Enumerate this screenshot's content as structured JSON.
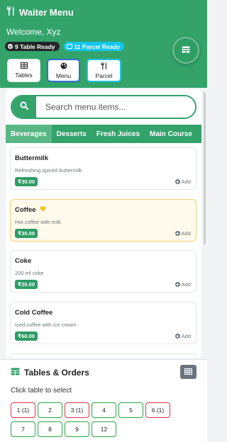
{
  "header": {
    "title": "Waiter Menu",
    "welcome": "Welcome, Xyz",
    "badges": {
      "tables_ready": "9 Table Ready",
      "parcel_ready": "11 Parcel Ready"
    },
    "nav": {
      "tables": "Tables",
      "menu": "Menu",
      "parcel": "Parcel"
    },
    "active_nav": "Menu"
  },
  "search": {
    "placeholder": "Search menu items..."
  },
  "tabs": [
    "Beverages",
    "Desserts",
    "Fresh Juices",
    "Main Course"
  ],
  "active_tab": "Beverages",
  "items": [
    {
      "name": "Buttermilk",
      "desc": "Refreshing spiced buttermilk",
      "price": "₹30.00",
      "add": "Add",
      "featured": false
    },
    {
      "name": "Coffee",
      "desc": "Hot coffee with milk",
      "price": "₹30.00",
      "add": "Add",
      "featured": true
    },
    {
      "name": "Coke",
      "desc": "200 ml coke",
      "price": "₹25.00",
      "add": "Add",
      "featured": false
    },
    {
      "name": "Cold Coffee",
      "desc": "Iced coffee with ice cream",
      "price": "₹60.00",
      "add": "Add",
      "featured": false
    }
  ],
  "tables_section": {
    "title": "Tables & Orders",
    "hint": "Click table to select",
    "tables": [
      {
        "label": "1 (1)",
        "status": "busy"
      },
      {
        "label": "2",
        "status": "free"
      },
      {
        "label": "3 (1)",
        "status": "busy"
      },
      {
        "label": "4",
        "status": "free"
      },
      {
        "label": "5",
        "status": "free"
      },
      {
        "label": "6 (1)",
        "status": "busy"
      },
      {
        "label": "7",
        "status": "free"
      },
      {
        "label": "8",
        "status": "free"
      },
      {
        "label": "9",
        "status": "free"
      },
      {
        "label": "12",
        "status": "free"
      }
    ]
  },
  "colors": {
    "primary": "#33a36a",
    "busy": "#dc3545",
    "free": "#28a745",
    "parcel": "#13c6ee",
    "featured": "#fffaeb"
  }
}
